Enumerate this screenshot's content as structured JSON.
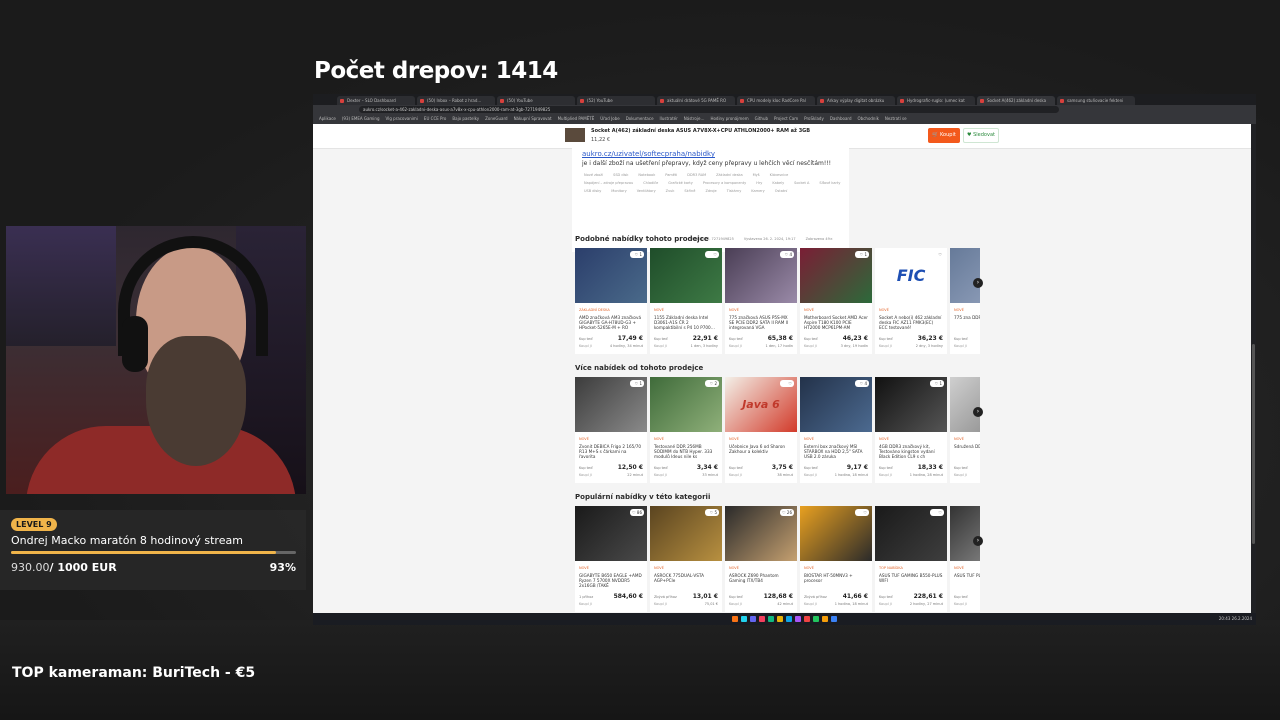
{
  "overlay": {
    "drop_count": "Počet drepov: 1414",
    "goal": {
      "level": "LEVEL 9",
      "title": "Ondrej Macko maratón 8 hodinový stream",
      "raised": "930.00",
      "total": "/ 1000 EUR",
      "percent_label": "93%",
      "progress": 0.93
    },
    "top_cameraman": "TOP kameraman: BuriTech - €5"
  },
  "browser": {
    "tabs": [
      "Dexter – SLO Dashboard",
      "(50) Inbox – Robot z hrad…",
      "(50) YouTube",
      "(52) YouTube",
      "aktuální drátové 5G PAMĚ RO",
      "CPU modely kloc RadCore Pal",
      "Arkay výplay digitat obrázku",
      "Hydrografic-ruglo: (umec kat",
      "Socket A(462) základní deska",
      "samsung stuňovacie fekteni"
    ],
    "active_tab": 8,
    "address": "aukro.cz/socket-a-462-zakladni-deska-asus-a7v8x-x-cpu-athlon2000-ram-at-3gb-7271949825",
    "bookmarks": [
      "Aplikace",
      "(93) EMEA Gaming",
      "Vlg pracovanimi",
      "EU CCE Pro",
      "Bajo pastelky",
      "ZoneGuard",
      "Nákupní Spravovat",
      "Multiplied PAMĚTĚ",
      "Úřad Jobe",
      "Dokumentace",
      "Ilustratér",
      "Nástroje…",
      "Hodiny pronájmem",
      "Github",
      "Project Cam",
      "ProSklady",
      "Dashboard",
      "Obchodník",
      "Neztratí se"
    ],
    "scroll_position": 0.45
  },
  "page": {
    "sticky": {
      "title": "Socket A(462) základní deska ASUS A7V8X-X+CPU ATHLON2000+ RAM až 3GB",
      "price": "11,22 €",
      "buy_label": "Koupit",
      "watch_label": "Sledovat"
    },
    "description": {
      "link": "aukro.cz/uzivatel/softecpraha/nabidky",
      "text": "je i další zboží na ušetření přepravy, když ceny přepravy u lehčích věcí nesčítám!!!",
      "categories": [
        "Nové zboží",
        "SSD disk",
        "Notebook",
        "Paměti",
        "DDR3 RAM",
        "Základní deska",
        "Myš",
        "Klávesnice",
        "Napájení – zdroje přepravou",
        "Chladiče",
        "Grafické karty",
        "Procesory a komponenty",
        "Hry",
        "Kabely",
        "Socket A",
        "Síťové karty",
        "USB disky",
        "Monitory",
        "Ventilátory",
        "Zvuk",
        "Skříně",
        "Zdroje",
        "Tiskárny",
        "Kamery",
        "Ostatní"
      ],
      "meta": [
        "Nabídka č. 7271949825",
        "Vystaveno 26. 2. 2024, 19:17",
        "Zobrazeno 49×"
      ]
    },
    "sections": [
      {
        "title": "Podobné nabídky tohoto prodejce",
        "items": [
          {
            "tag": "ZÁKLADNÍ DESKA",
            "title": "AMD značková AM3 značková GIGABYTE GA-H78UD-G3 + HPocket-5265E-M + RO",
            "price": "17,49 €",
            "lbl1": "Kup teď",
            "lbl2": "Koupí ji",
            "time": "4 hodiny, 34 minut",
            "likes": "1",
            "c1": "#2b3e6b",
            "c2": "#4a6a8a"
          },
          {
            "tag": "NOVÉ",
            "title": "1155 Základní deska Intel D3061-A1S ČR 2 kompaktibilní s P4 10 P700…",
            "price": "22,91 €",
            "lbl1": "Kup teď",
            "lbl2": "Koupí ji",
            "time": "1 den, 3 hodiny",
            "likes": "",
            "c1": "#1f4d2a",
            "c2": "#3e7a45"
          },
          {
            "tag": "NOVÉ",
            "title": "775 značková ASUS P5S-MX SE PCIE DDR2 SATA II RAM II integrovaná VGA",
            "price": "65,38 €",
            "lbl1": "Kup teď",
            "lbl2": "Koupí ji",
            "time": "1 den, 17 hodin",
            "likes": "4",
            "c1": "#4a3e55",
            "c2": "#9a8aa8"
          },
          {
            "tag": "NOVÉ",
            "title": "Motherboard Socket AMD Acer Aspire T180 K100 PCIE HT2000 MCP61PM-AM",
            "price": "46,23 €",
            "lbl1": "Kup teď",
            "lbl2": "Koupí ji",
            "time": "3 dny, 19 hodin",
            "likes": "1",
            "c1": "#7a1e35",
            "c2": "#2c6a3a"
          },
          {
            "tag": "NOVÉ",
            "title": "Socket A nebo(i) 462 základní deska FIC AZ11 FMK3(EC) ECC testované!",
            "price": "36,23 €",
            "lbl1": "Kup teď",
            "lbl2": "Koupí ji",
            "time": "2 dny, 3 hodiny",
            "likes": "",
            "c1": "#ffffff",
            "c2": "#ffffff",
            "logo": "FIC"
          },
          {
            "tag": "NOVÉ",
            "title": "775 zna DDR2 S",
            "price": "",
            "lbl1": "Kup teď",
            "lbl2": "Koupí ji",
            "time": "",
            "likes": "",
            "c1": "#667a99",
            "c2": "#8898b4"
          }
        ]
      },
      {
        "title": "Více nabídek od tohoto prodejce",
        "items": [
          {
            "tag": "NOVÉ",
            "title": "Zvonit DEBICA Frigo 2 165/70 R13 M+S s čárkami na řavorita",
            "price": "12,50 €",
            "lbl1": "Kup teď",
            "lbl2": "Koupí ji",
            "time": "22 minut",
            "likes": "1",
            "c1": "#3c3c3c",
            "c2": "#8a8a8a"
          },
          {
            "tag": "NOVÉ",
            "title": "Testované DDR 256MB SODIMM do NTB Hyper. 333 modulů Ideus nile ks",
            "price": "3,34 €",
            "lbl1": "Kup teď",
            "lbl2": "Koupí ji",
            "time": "33 minut",
            "likes": "2",
            "c1": "#3f6b3a",
            "c2": "#8fb07a"
          },
          {
            "tag": "NOVÉ",
            "title": "Učebnice Java 6 od Sharon Zakhour a kolektiv",
            "price": "3,75 €",
            "lbl1": "Kup teď",
            "lbl2": "Koupí ji",
            "time": "38 minut",
            "likes": "",
            "c1": "#f3f0e8",
            "c2": "#d23a2a",
            "logo": "Java 6"
          },
          {
            "tag": "NOVÉ",
            "title": "Externí box značkový MSI STARBOX na HDD 2,5\" SATA USB 2.0 záruka",
            "price": "9,17 €",
            "lbl1": "Kup teď",
            "lbl2": "Koupí ji",
            "time": "1 hodina, 18 minut",
            "likes": "4",
            "c1": "#23324a",
            "c2": "#4c6a90"
          },
          {
            "tag": "NOVÉ",
            "title": "4GB DDR3 značkový kit, Testováno kingston vydaní Black Edition CL9 s ch",
            "price": "18,33 €",
            "lbl1": "Kup teď",
            "lbl2": "Koupí ji",
            "time": "1 hodina, 28 minut",
            "likes": "1",
            "c1": "#111111",
            "c2": "#555555"
          },
          {
            "tag": "NOVÉ",
            "title": "Sdružená DDR3 4GB",
            "price": "",
            "lbl1": "Kup teď",
            "lbl2": "Koupí ji",
            "time": "",
            "likes": "",
            "c1": "#cfcfcf",
            "c2": "#9a9a9a"
          }
        ]
      },
      {
        "title": "Populární nabídky v této kategorii",
        "items": [
          {
            "tag": "NOVÉ",
            "title": "GIGABYTE B650 EAGLE +AMD Ryzen 7 5700X NVDDR5 2x16GB /TAKĚ",
            "price": "584,60 €",
            "lbl1": "1 příhoz",
            "lbl2": "Koupí ji",
            "time": "",
            "likes": "86",
            "c1": "#1a1a1a",
            "c2": "#4a4a4a"
          },
          {
            "tag": "NOVÉ",
            "title": "ASROCK 775DUAL-VSTA AGP+PCIe",
            "price": "13,01 €",
            "lbl1": "Zbývá příhoz",
            "lbl2": "Koupí ji",
            "time": "75,01 €",
            "likes": "5",
            "c1": "#5a4420",
            "c2": "#b89040"
          },
          {
            "tag": "NOVÉ",
            "title": "ASROCK Z690 Phantom Gaming ITX/TB4",
            "price": "128,68 €",
            "lbl1": "Kup teď",
            "lbl2": "Koupí ji",
            "time": "42 minut",
            "likes": "26",
            "c1": "#2a2a2a",
            "c2": "#c5a070"
          },
          {
            "tag": "NOVÉ",
            "title": "BIOSTAR HT-50MNV3 + procesor",
            "price": "41,66 €",
            "lbl1": "Zbývá příhoz",
            "lbl2": "Koupí ji",
            "time": "1 hodina, 18 minut",
            "likes": "",
            "c1": "#e8a020",
            "c2": "#2a2a2a"
          },
          {
            "tag": "TOP NABÍDKA",
            "title": "ASUS TUF GAMING B550-PLUS WIFI",
            "price": "228,61 €",
            "lbl1": "Kup teď",
            "lbl2": "Koupí ji",
            "time": "2 hodiny, 27 minut",
            "likes": "",
            "c1": "#1a1a1a",
            "c2": "#3e3e3e"
          },
          {
            "tag": "NOVÉ",
            "title": "ASUS TUF PLUS WIFI",
            "price": "",
            "lbl1": "Kup teď",
            "lbl2": "Koupí ji",
            "time": "",
            "likes": "",
            "c1": "#333333",
            "c2": "#777777"
          }
        ]
      }
    ]
  },
  "taskbar": {
    "icon_colors": [
      "#3b82f6",
      "#f59e0b",
      "#22c55e",
      "#ef4444",
      "#a855f7",
      "#0ea5e9",
      "#eab308",
      "#10b981",
      "#f43f5e",
      "#6366f1",
      "#22d3ee",
      "#f97316"
    ],
    "tray": "20:43 26.2.2024"
  }
}
